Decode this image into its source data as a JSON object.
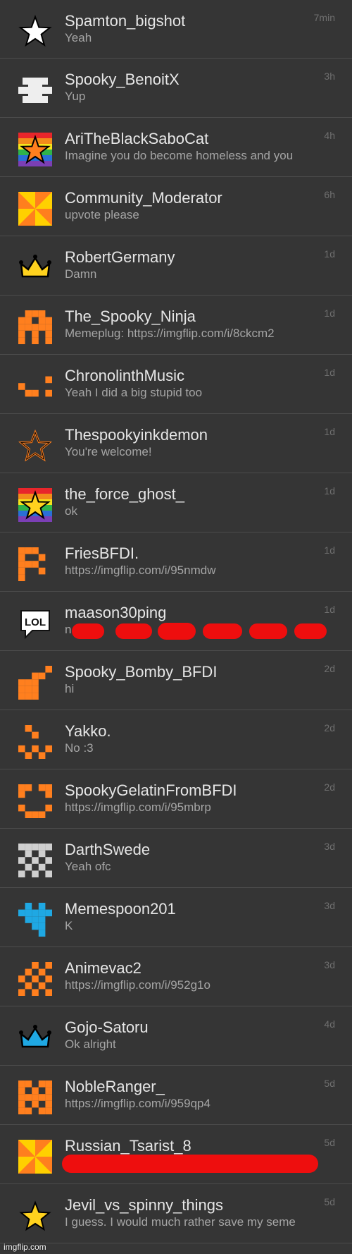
{
  "colors": {
    "background": "#363636",
    "divider": "#4c4c4c",
    "username": "#e6e6e6",
    "preview": "#a5a5a5",
    "time": "#6f6f6f",
    "redaction": "#ee0e0e",
    "orange": "#ff7f1e",
    "blue": "#1fa8e3"
  },
  "conversations": [
    {
      "username": "Spamton_bigshot",
      "preview": "Yeah",
      "time": "7min",
      "icon": "white-star-icon"
    },
    {
      "username": "Spooky_BenoitX",
      "preview": "Yup",
      "time": "3h",
      "icon": "white-bars-icon"
    },
    {
      "username": "AriTheBlackSaboCat",
      "preview": "Imagine you do become homeless and you",
      "time": "4h",
      "icon": "rainbow-orange-star-icon"
    },
    {
      "username": "Community_Moderator",
      "preview": "upvote please",
      "time": "6h",
      "icon": "orange-pinwheel-icon"
    },
    {
      "username": "RobertGermany",
      "preview": "Damn",
      "time": "1d",
      "icon": "gold-crown-icon"
    },
    {
      "username": "The_Spooky_Ninja",
      "preview": "Memeplug: https://imgflip.com/i/8ckcm2",
      "time": "1d",
      "icon": "orange-pixel-ghost-icon"
    },
    {
      "username": "ChronolinthMusic",
      "preview": "Yeah I did a big stupid too",
      "time": "1d",
      "icon": "orange-pixel-dots-icon"
    },
    {
      "username": "Thespookyinkdemon",
      "preview": "You're welcome!",
      "time": "1d",
      "icon": "orange-star-outline-icon"
    },
    {
      "username": "the_force_ghost_",
      "preview": "ok",
      "time": "1d",
      "icon": "rainbow-gold-star-icon"
    },
    {
      "username": "FriesBFDI.",
      "preview": "https://imgflip.com/i/95nmdw",
      "time": "1d",
      "icon": "orange-pixel-f-icon"
    },
    {
      "username": "maason30ping",
      "preview": "n",
      "time": "1d",
      "icon": "lol-bubble-icon"
    },
    {
      "username": "Spooky_Bomby_BFDI",
      "preview": "hi",
      "time": "2d",
      "icon": "orange-pixel-bomb-icon"
    },
    {
      "username": "Yakko.",
      "preview": "No :3",
      "time": "2d",
      "icon": "orange-pixel-face-icon"
    },
    {
      "username": "SpookyGelatinFromBFDI",
      "preview": "https://imgflip.com/i/95mbrp",
      "time": "2d",
      "icon": "orange-pixel-smile-icon"
    },
    {
      "username": "DarthSwede",
      "preview": "Yeah ofc",
      "time": "3d",
      "icon": "gray-checker-icon"
    },
    {
      "username": "Memespoon201",
      "preview": "K",
      "time": "3d",
      "icon": "blue-pixel-icon"
    },
    {
      "username": "Animevac2",
      "preview": "https://imgflip.com/i/952g1o",
      "time": "3d",
      "icon": "orange-checker-icon"
    },
    {
      "username": "Gojo-Satoru",
      "preview": "Ok alright",
      "time": "4d",
      "icon": "blue-crown-icon"
    },
    {
      "username": "NobleRanger_",
      "preview": "https://imgflip.com/i/959qp4",
      "time": "5d",
      "icon": "orange-pixel-h-icon"
    },
    {
      "username": "Russian_Tsarist_8",
      "preview": "",
      "time": "5d",
      "icon": "orange-pinwheel-icon"
    },
    {
      "username": "Jevil_vs_spinny_things",
      "preview": "I guess. I would much rather save my seme",
      "time": "5d",
      "icon": "gold-star-icon"
    }
  ],
  "watermark": "imgflip.com"
}
